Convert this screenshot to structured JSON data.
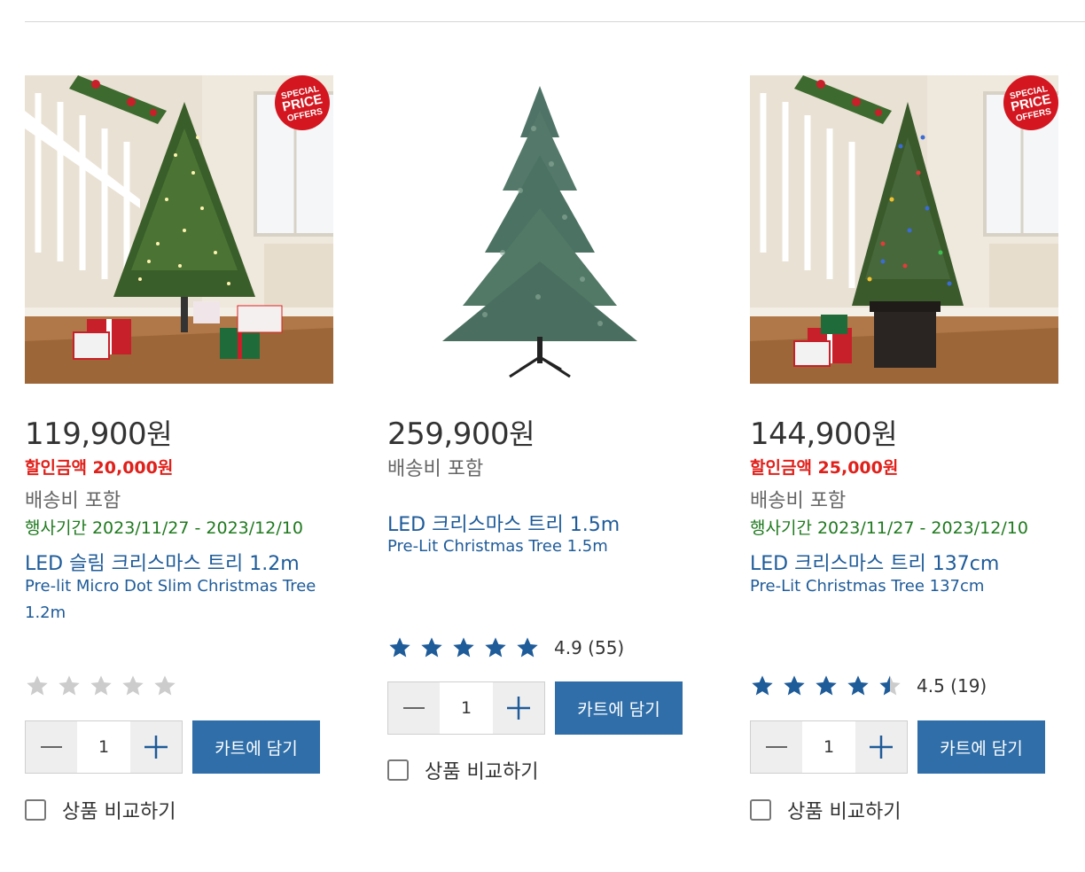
{
  "cart_label": "카트에 담기",
  "compare_label": "상품 비교하기",
  "badge": {
    "line1": "SPECIAL",
    "line2": "PRICE",
    "line3": "OFFERS"
  },
  "colors": {
    "link": "#1e5b99",
    "discount": "#e0201a",
    "event": "#1f7a1f",
    "cart_button": "#2f6ea8",
    "star_filled": "#1e5b99",
    "star_empty": "#cccccc"
  },
  "products": [
    {
      "price": "119,900",
      "currency": "원",
      "discount_label": "할인금액 20,000원",
      "shipping": "배송비 포함",
      "event_label": "행사기간",
      "event_dates": "2023/11/27 - 2023/12/10",
      "title_ko": "LED 슬림 크리스마스 트리 1.2m",
      "title_en": "Pre-lit Micro Dot Slim Christmas Tree 1.2m",
      "rating": 0,
      "rating_text": "",
      "quantity": "1",
      "image": "christmas-tree-room-warm-lights"
    },
    {
      "price": "259,900",
      "currency": "원",
      "shipping": "배송비 포함",
      "title_ko": "LED 크리스마스 트리 1.5m",
      "title_en": "Pre-Lit Christmas Tree 1.5m",
      "rating": 4.9,
      "rating_text": "4.9 (55)",
      "quantity": "1",
      "image": "christmas-tree-white-background"
    },
    {
      "price": "144,900",
      "currency": "원",
      "discount_label": "할인금액 25,000원",
      "shipping": "배송비 포함",
      "event_label": "행사기간",
      "event_dates": "2023/11/27 - 2023/12/10",
      "title_ko": "LED 크리스마스 트리 137cm",
      "title_en": "Pre-Lit Christmas Tree 137cm",
      "rating": 4.5,
      "rating_text": "4.5 (19)",
      "quantity": "1",
      "image": "christmas-tree-room-colored-lights-planter"
    }
  ]
}
